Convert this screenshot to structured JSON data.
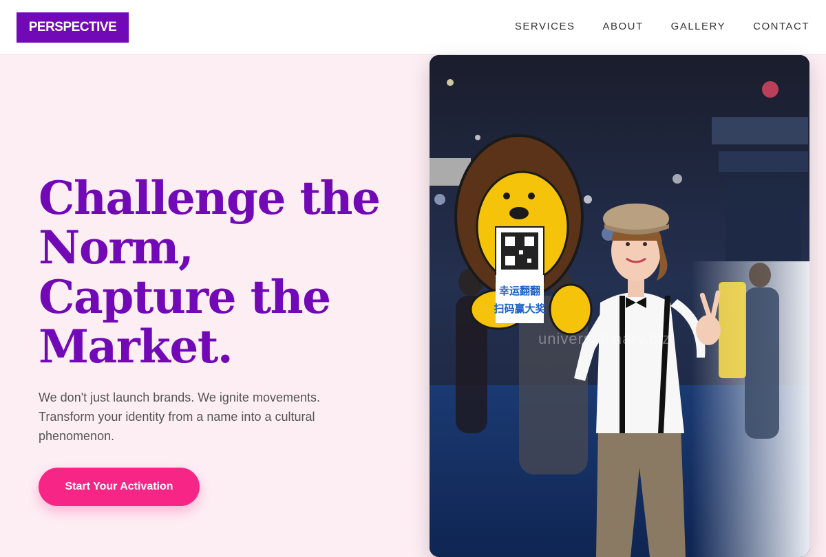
{
  "header": {
    "logo": "PERSPECTIVE",
    "nav": [
      "SERVICES",
      "ABOUT",
      "GALLERY",
      "CONTACT"
    ]
  },
  "hero": {
    "headline": [
      "Challenge the",
      "Norm,",
      "Capture the",
      "Market."
    ],
    "subtext": "We don't just launch brands. We ignite movements. Transform your identity from a name into a cultural phenomenon.",
    "cta_label": "Start Your Activation",
    "image": {
      "sign_text_line1": "幸运翻翻",
      "sign_text_line2": "扫码赢大奖",
      "watermark": "universalimary.biz"
    }
  },
  "colors": {
    "brand_purple": "#7209b7",
    "accent_pink": "#f72585",
    "hero_bg": "#fdeef4"
  },
  "icons": [
    "lion-mascot-sign",
    "qr-code"
  ]
}
